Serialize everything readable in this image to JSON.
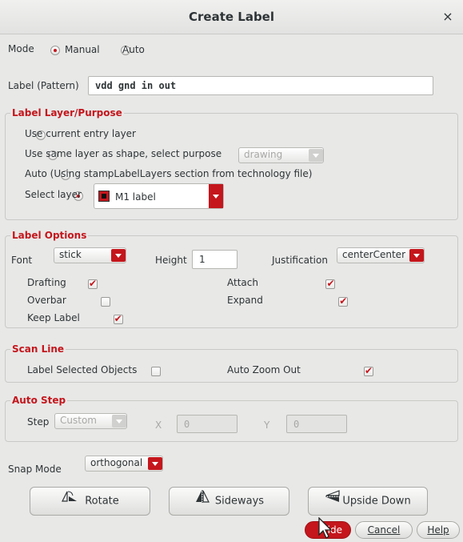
{
  "window": {
    "title": "Create Label",
    "close_glyph": "×"
  },
  "mode": {
    "label": "Mode",
    "options": [
      "Manual",
      "Auto"
    ],
    "selected": "Manual"
  },
  "label_pattern": {
    "label": "Label (Pattern)",
    "value": "vdd gnd in out"
  },
  "layer_purpose": {
    "title": "Label Layer/Purpose",
    "options": [
      "Use current entry layer",
      "Use same layer as shape, select purpose",
      "Auto (Using stampLabelLayers section from technology file)",
      "Select layer"
    ],
    "selected": "Select layer",
    "purpose_value": "drawing",
    "layer_value": "M1 label"
  },
  "label_options": {
    "title": "Label Options",
    "font_label": "Font",
    "font_value": "stick",
    "height_label": "Height",
    "height_value": "1",
    "justification_label": "Justification",
    "justification_value": "centerCenter",
    "drafting": "Drafting",
    "overbar": "Overbar",
    "keep_label": "Keep Label",
    "attach": "Attach",
    "expand": "Expand"
  },
  "scan_line": {
    "title": "Scan Line",
    "label_selected": "Label Selected Objects",
    "auto_zoom": "Auto Zoom Out"
  },
  "auto_step": {
    "title": "Auto Step",
    "step": "Step",
    "step_value": "Custom",
    "x_label": "X",
    "x_value": "0",
    "y_label": "Y",
    "y_value": "0"
  },
  "snap": {
    "label": "Snap Mode",
    "value": "orthogonal"
  },
  "buttons": {
    "rotate": "Rotate",
    "sideways": "Sideways",
    "upside_down": "Upside Down",
    "hide": "ide",
    "cancel": "Cancel",
    "help": "Help"
  },
  "colors": {
    "accent": "#c4161c",
    "background": "#e8e8e7"
  }
}
